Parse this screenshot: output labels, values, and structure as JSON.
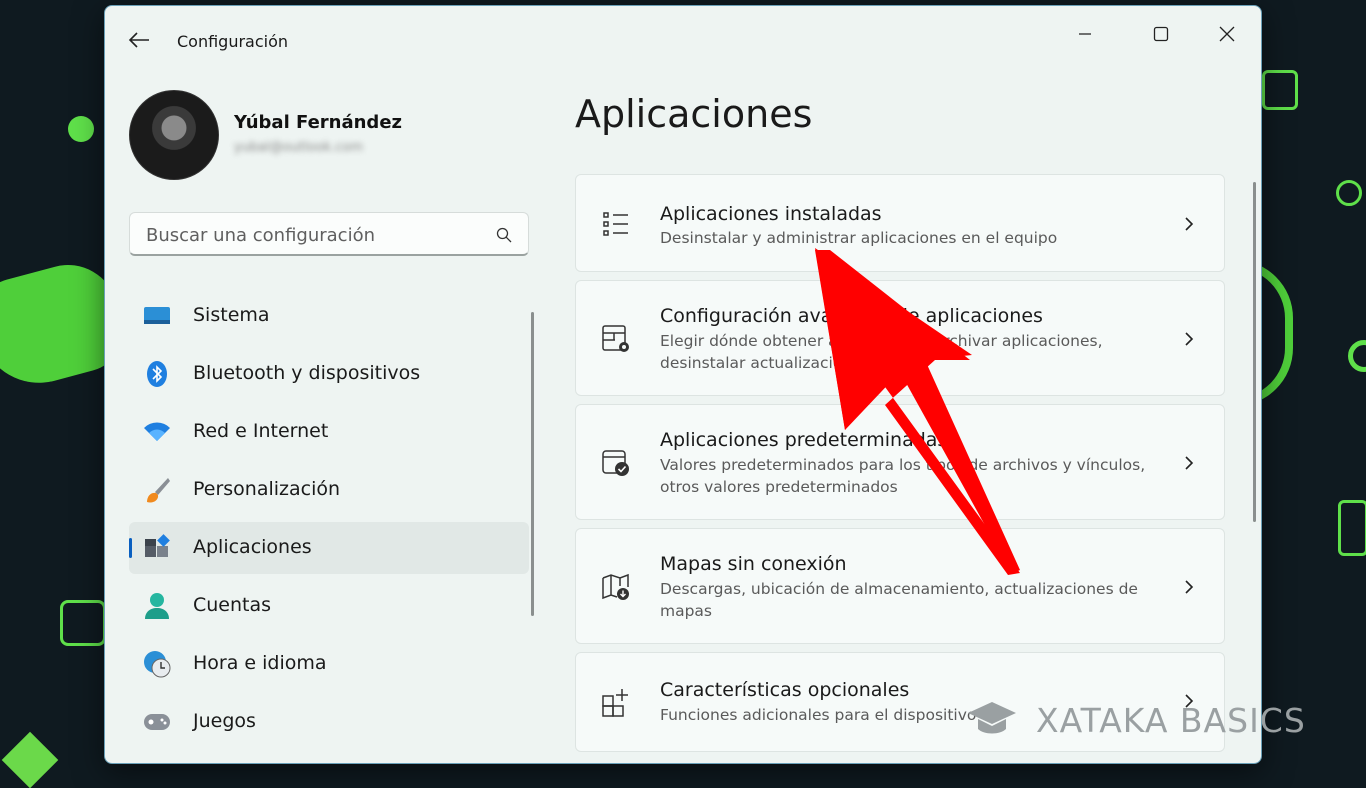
{
  "window": {
    "title": "Configuración"
  },
  "user": {
    "name": "Yúbal Fernández",
    "email": "yubal@outlook.com"
  },
  "search": {
    "placeholder": "Buscar una configuración"
  },
  "sidebar": {
    "items": [
      {
        "label": "Sistema",
        "icon": "monitor-icon",
        "active": false
      },
      {
        "label": "Bluetooth y dispositivos",
        "icon": "bluetooth-icon",
        "active": false
      },
      {
        "label": "Red e Internet",
        "icon": "wifi-icon",
        "active": false
      },
      {
        "label": "Personalización",
        "icon": "brush-icon",
        "active": false
      },
      {
        "label": "Aplicaciones",
        "icon": "apps-icon",
        "active": true
      },
      {
        "label": "Cuentas",
        "icon": "account-icon",
        "active": false
      },
      {
        "label": "Hora e idioma",
        "icon": "clock-globe-icon",
        "active": false
      },
      {
        "label": "Juegos",
        "icon": "gamepad-icon",
        "active": false
      }
    ]
  },
  "main": {
    "title": "Aplicaciones",
    "cards": [
      {
        "title": "Aplicaciones instaladas",
        "description": "Desinstalar y administrar aplicaciones en el equipo",
        "icon": "list-icon"
      },
      {
        "title": "Configuración avanzada de aplicaciones",
        "description": "Elegir dónde obtener aplicaciones, archivar aplicaciones, desinstalar actualizaciones",
        "icon": "app-settings-icon"
      },
      {
        "title": "Aplicaciones predeterminadas",
        "description": "Valores predeterminados para los tipos de archivos y vínculos, otros valores predeterminados",
        "icon": "default-apps-icon"
      },
      {
        "title": "Mapas sin conexión",
        "description": "Descargas, ubicación de almacenamiento, actualizaciones de mapas",
        "icon": "offline-map-icon"
      },
      {
        "title": "Características opcionales",
        "description": "Funciones adicionales para el dispositivo",
        "icon": "optional-features-icon"
      }
    ]
  },
  "watermark": {
    "text": "XATAKA BASICS"
  },
  "colors": {
    "accent": "#0a5fc0",
    "arrow": "#ff0000",
    "window_bg": "#eef4f2"
  }
}
